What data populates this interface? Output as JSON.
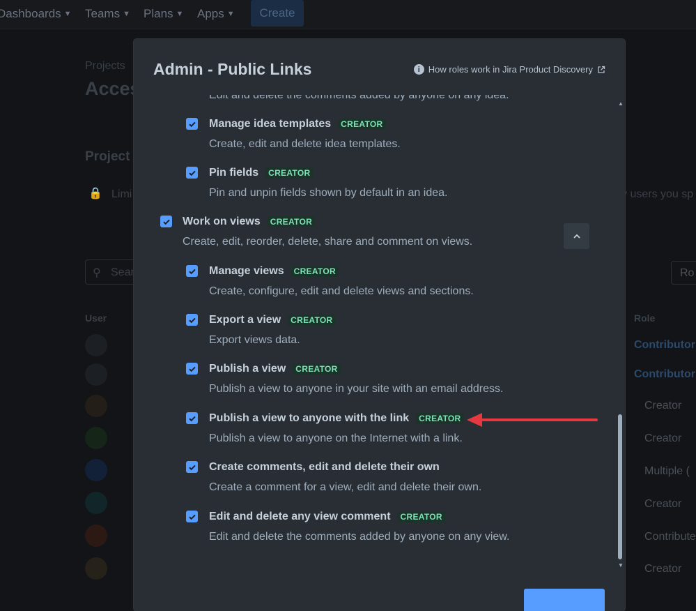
{
  "topnav": {
    "dashboards": "Dashboards",
    "teams": "Teams",
    "plans": "Plans",
    "apps": "Apps",
    "create": "Create"
  },
  "background": {
    "breadcrumb": "Projects",
    "page_title": "Acces",
    "section_title": "Project a",
    "lock_text": "Limi",
    "lock_text_right": "y users you sp",
    "search_placeholder": "Sear",
    "role_button": "Ro",
    "col_user": "User",
    "col_role": "Role",
    "roles": [
      "Contributor",
      "Contributor",
      "Creator",
      "Creator",
      "Multiple (",
      "Creator",
      "Contribute",
      "Creator"
    ]
  },
  "modal": {
    "title": "Admin - Public Links",
    "help_link": "How roles work in Jira Product Discovery",
    "cut_text": "Edit and delete the comments added by anyone on any idea.",
    "permissions": [
      {
        "title": "Manage idea templates",
        "badge": "CREATOR",
        "desc": "Create, edit and delete idea templates.",
        "checked": true
      },
      {
        "title": "Pin fields",
        "badge": "CREATOR",
        "desc": "Pin and unpin fields shown by default in an idea.",
        "checked": true
      },
      {
        "title": "Work on views",
        "badge": "CREATOR",
        "desc": "Create, edit, reorder, delete, share and comment on views.",
        "checked": true
      },
      {
        "title": "Manage views",
        "badge": "CREATOR",
        "desc": "Create, configure, edit and delete views and sections.",
        "checked": true
      },
      {
        "title": "Export a view",
        "badge": "CREATOR",
        "desc": "Export views data.",
        "checked": true
      },
      {
        "title": "Publish a view",
        "badge": "CREATOR",
        "desc": "Publish a view to anyone in your site with an email address.",
        "checked": true
      },
      {
        "title": "Publish a view to anyone with the link",
        "badge": "CREATOR",
        "desc": "Publish a view to anyone on the Internet with a link.",
        "checked": true
      },
      {
        "title": "Create comments, edit and delete their own",
        "badge": "",
        "desc": "Create a comment for a view, edit and delete their own.",
        "checked": true
      },
      {
        "title": "Edit and delete any view comment",
        "badge": "CREATOR",
        "desc": "Edit and delete the comments added by anyone on any view.",
        "checked": true
      }
    ]
  },
  "colors": {
    "accent": "#579dff",
    "badge_text": "#7ee2b8",
    "arrow": "#e5393f"
  }
}
